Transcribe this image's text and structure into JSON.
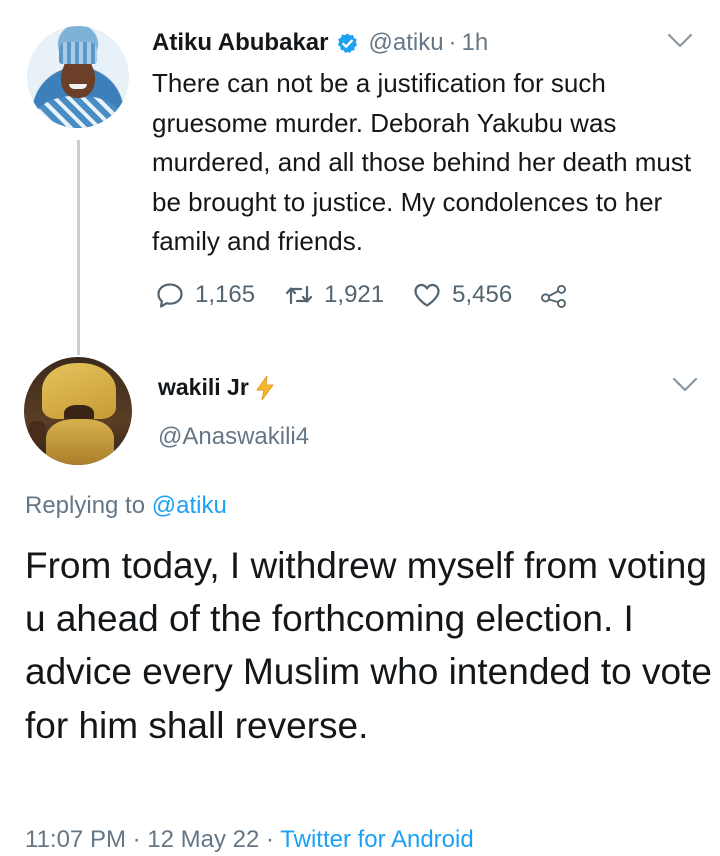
{
  "original_tweet": {
    "display_name": "Atiku Abubakar",
    "handle": "@atiku",
    "separator": "·",
    "time": "1h",
    "body": "There can not be a justification for such gruesome murder. Deborah Yakubu was murdered, and all those behind her death must be brought to justice. My condolences to her family and friends.",
    "avatar_icon": "profile-photo",
    "verified_icon": "verified-badge-icon",
    "verified_color": "#1da1f2",
    "stats": {
      "replies": "1,165",
      "retweets": "1,921",
      "likes": "5,456"
    }
  },
  "reply_tweet": {
    "display_name": "wakili Jr",
    "name_emoji_icon": "lightning-bolt-icon",
    "handle": "@Anaswakili4",
    "replying_prefix": "Replying to",
    "replying_to": "@atiku",
    "body": "From today, I withdrew myself from voting u ahead of the forthcoming election. I advice every Muslim who intended to vote for him shall reverse.",
    "time": "11:07 PM",
    "date": "12 May 22",
    "separator": "·",
    "source": "Twitter for Android"
  },
  "colors": {
    "text_primary": "#14171a",
    "text_secondary": "#657786",
    "accent": "#1da1f2",
    "thread_line": "#c4cfd6"
  }
}
